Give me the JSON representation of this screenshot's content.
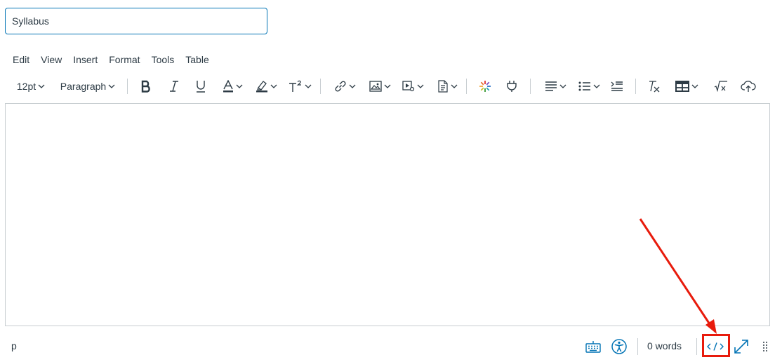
{
  "title_field": {
    "value": "Syllabus"
  },
  "menubar": {
    "items": [
      "Edit",
      "View",
      "Insert",
      "Format",
      "Tools",
      "Table"
    ]
  },
  "toolbar": {
    "font_size": "12pt",
    "block_format": "Paragraph"
  },
  "statusbar": {
    "element_path": "p",
    "word_count": "0 words"
  },
  "colors": {
    "accent": "#0374b5",
    "annotation": "#e81b0c",
    "border": "#c7cdd1",
    "text": "#2d3b45"
  },
  "icons": [
    "bold-icon",
    "italic-icon",
    "underline-icon",
    "text-color-icon",
    "highlight-color-icon",
    "superscript-icon",
    "link-icon",
    "image-icon",
    "media-icon",
    "document-icon",
    "apps-icon",
    "plugin-icon",
    "align-icon",
    "list-icon",
    "indent-icon",
    "clear-format-icon",
    "table-icon",
    "math-icon",
    "cloud-upload-icon",
    "keyboard-icon",
    "accessibility-icon",
    "html-editor-icon",
    "fullscreen-icon",
    "resize-handle-icon"
  ]
}
